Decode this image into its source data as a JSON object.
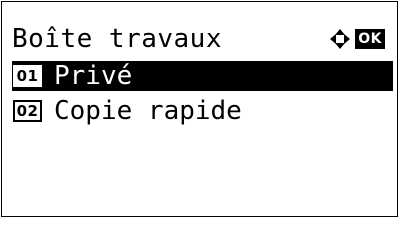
{
  "header": {
    "title": "Boîte travaux",
    "nav_icon": "up-down-left-right-arrows-icon",
    "ok_label": "OK"
  },
  "menu": {
    "items": [
      {
        "number": "01",
        "label": "Privé",
        "selected": true
      },
      {
        "number": "02",
        "label": "Copie rapide",
        "selected": false
      }
    ]
  },
  "colors": {
    "foreground": "#000000",
    "background": "#ffffff",
    "highlight": "#000000",
    "highlight_text": "#ffffff"
  }
}
